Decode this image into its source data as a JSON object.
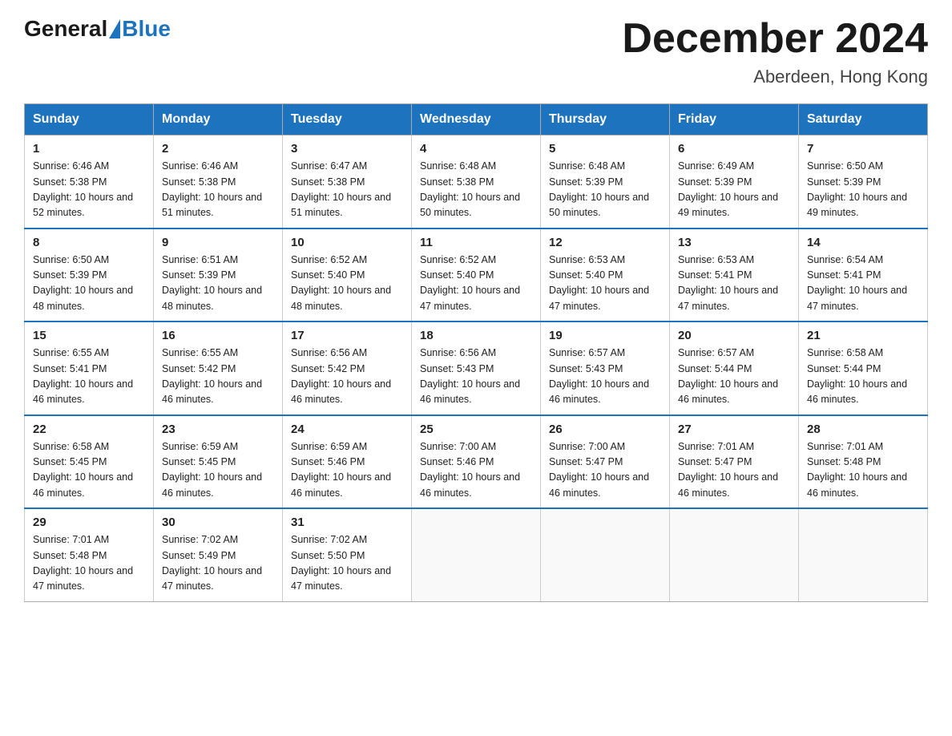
{
  "header": {
    "logo_general": "General",
    "logo_blue": "Blue",
    "month_year": "December 2024",
    "location": "Aberdeen, Hong Kong"
  },
  "weekdays": [
    "Sunday",
    "Monday",
    "Tuesday",
    "Wednesday",
    "Thursday",
    "Friday",
    "Saturday"
  ],
  "rows": [
    [
      {
        "day": "1",
        "sunrise": "6:46 AM",
        "sunset": "5:38 PM",
        "daylight": "10 hours and 52 minutes."
      },
      {
        "day": "2",
        "sunrise": "6:46 AM",
        "sunset": "5:38 PM",
        "daylight": "10 hours and 51 minutes."
      },
      {
        "day": "3",
        "sunrise": "6:47 AM",
        "sunset": "5:38 PM",
        "daylight": "10 hours and 51 minutes."
      },
      {
        "day": "4",
        "sunrise": "6:48 AM",
        "sunset": "5:38 PM",
        "daylight": "10 hours and 50 minutes."
      },
      {
        "day": "5",
        "sunrise": "6:48 AM",
        "sunset": "5:39 PM",
        "daylight": "10 hours and 50 minutes."
      },
      {
        "day": "6",
        "sunrise": "6:49 AM",
        "sunset": "5:39 PM",
        "daylight": "10 hours and 49 minutes."
      },
      {
        "day": "7",
        "sunrise": "6:50 AM",
        "sunset": "5:39 PM",
        "daylight": "10 hours and 49 minutes."
      }
    ],
    [
      {
        "day": "8",
        "sunrise": "6:50 AM",
        "sunset": "5:39 PM",
        "daylight": "10 hours and 48 minutes."
      },
      {
        "day": "9",
        "sunrise": "6:51 AM",
        "sunset": "5:39 PM",
        "daylight": "10 hours and 48 minutes."
      },
      {
        "day": "10",
        "sunrise": "6:52 AM",
        "sunset": "5:40 PM",
        "daylight": "10 hours and 48 minutes."
      },
      {
        "day": "11",
        "sunrise": "6:52 AM",
        "sunset": "5:40 PM",
        "daylight": "10 hours and 47 minutes."
      },
      {
        "day": "12",
        "sunrise": "6:53 AM",
        "sunset": "5:40 PM",
        "daylight": "10 hours and 47 minutes."
      },
      {
        "day": "13",
        "sunrise": "6:53 AM",
        "sunset": "5:41 PM",
        "daylight": "10 hours and 47 minutes."
      },
      {
        "day": "14",
        "sunrise": "6:54 AM",
        "sunset": "5:41 PM",
        "daylight": "10 hours and 47 minutes."
      }
    ],
    [
      {
        "day": "15",
        "sunrise": "6:55 AM",
        "sunset": "5:41 PM",
        "daylight": "10 hours and 46 minutes."
      },
      {
        "day": "16",
        "sunrise": "6:55 AM",
        "sunset": "5:42 PM",
        "daylight": "10 hours and 46 minutes."
      },
      {
        "day": "17",
        "sunrise": "6:56 AM",
        "sunset": "5:42 PM",
        "daylight": "10 hours and 46 minutes."
      },
      {
        "day": "18",
        "sunrise": "6:56 AM",
        "sunset": "5:43 PM",
        "daylight": "10 hours and 46 minutes."
      },
      {
        "day": "19",
        "sunrise": "6:57 AM",
        "sunset": "5:43 PM",
        "daylight": "10 hours and 46 minutes."
      },
      {
        "day": "20",
        "sunrise": "6:57 AM",
        "sunset": "5:44 PM",
        "daylight": "10 hours and 46 minutes."
      },
      {
        "day": "21",
        "sunrise": "6:58 AM",
        "sunset": "5:44 PM",
        "daylight": "10 hours and 46 minutes."
      }
    ],
    [
      {
        "day": "22",
        "sunrise": "6:58 AM",
        "sunset": "5:45 PM",
        "daylight": "10 hours and 46 minutes."
      },
      {
        "day": "23",
        "sunrise": "6:59 AM",
        "sunset": "5:45 PM",
        "daylight": "10 hours and 46 minutes."
      },
      {
        "day": "24",
        "sunrise": "6:59 AM",
        "sunset": "5:46 PM",
        "daylight": "10 hours and 46 minutes."
      },
      {
        "day": "25",
        "sunrise": "7:00 AM",
        "sunset": "5:46 PM",
        "daylight": "10 hours and 46 minutes."
      },
      {
        "day": "26",
        "sunrise": "7:00 AM",
        "sunset": "5:47 PM",
        "daylight": "10 hours and 46 minutes."
      },
      {
        "day": "27",
        "sunrise": "7:01 AM",
        "sunset": "5:47 PM",
        "daylight": "10 hours and 46 minutes."
      },
      {
        "day": "28",
        "sunrise": "7:01 AM",
        "sunset": "5:48 PM",
        "daylight": "10 hours and 46 minutes."
      }
    ],
    [
      {
        "day": "29",
        "sunrise": "7:01 AM",
        "sunset": "5:48 PM",
        "daylight": "10 hours and 47 minutes."
      },
      {
        "day": "30",
        "sunrise": "7:02 AM",
        "sunset": "5:49 PM",
        "daylight": "10 hours and 47 minutes."
      },
      {
        "day": "31",
        "sunrise": "7:02 AM",
        "sunset": "5:50 PM",
        "daylight": "10 hours and 47 minutes."
      },
      null,
      null,
      null,
      null
    ]
  ]
}
